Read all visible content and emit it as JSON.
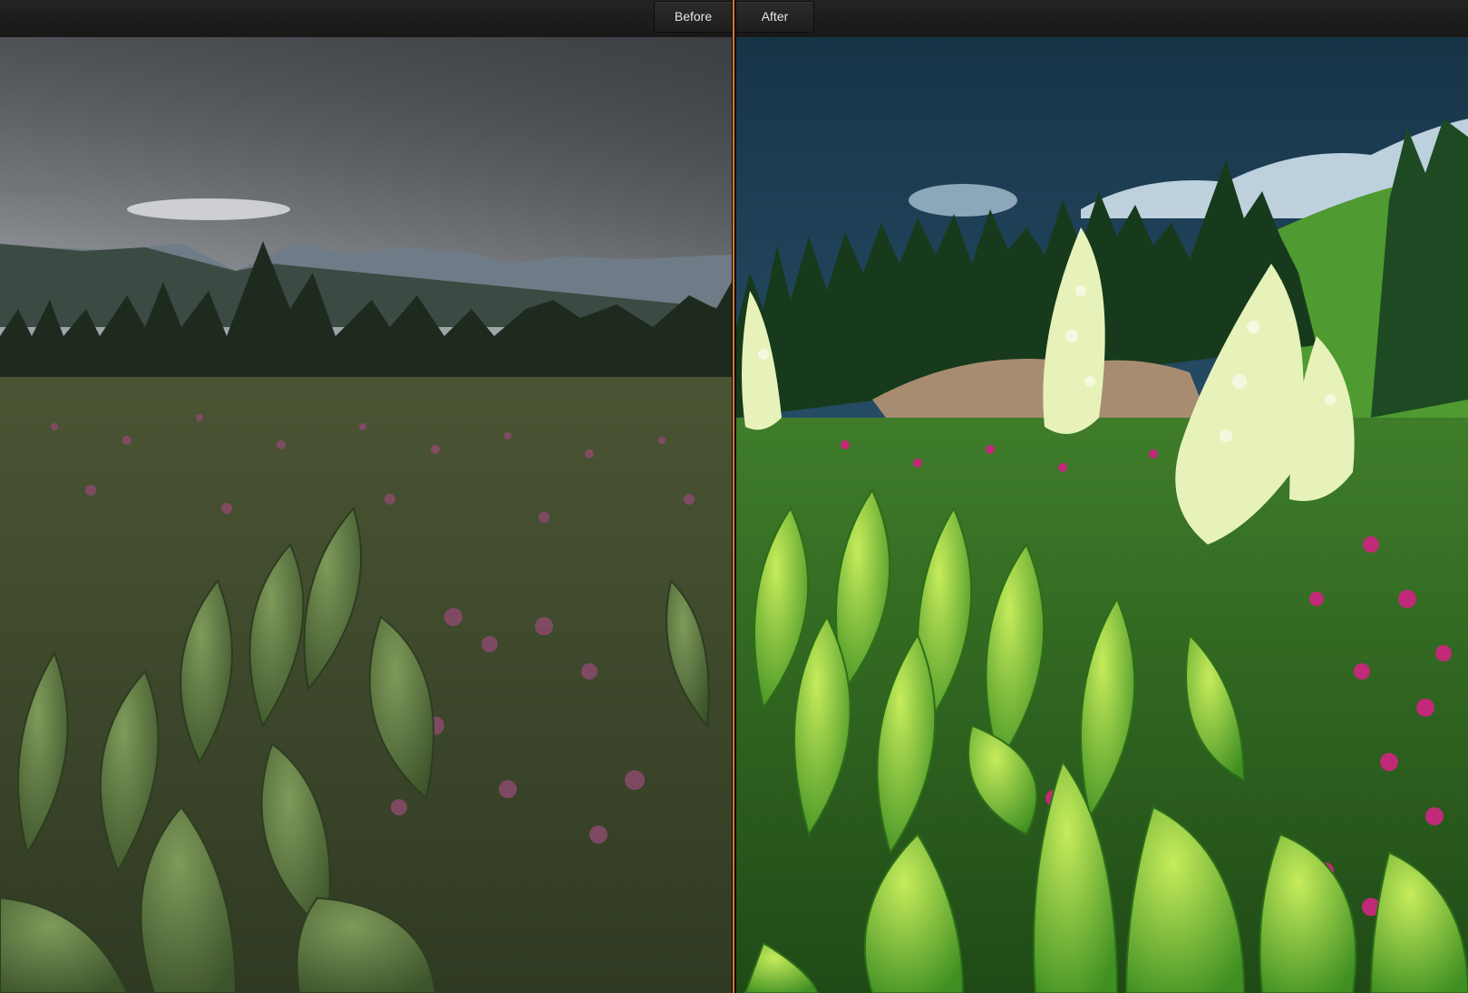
{
  "toolbar": {
    "before_label": "Before",
    "after_label": "After"
  },
  "panes": {
    "before": {
      "icon": "photo-before-image"
    },
    "after": {
      "icon": "photo-after-image"
    }
  },
  "colors": {
    "divider_accent": "#d9772b",
    "toolbar_bg": "#1e1e1e",
    "label_text": "#e6e6e6"
  }
}
